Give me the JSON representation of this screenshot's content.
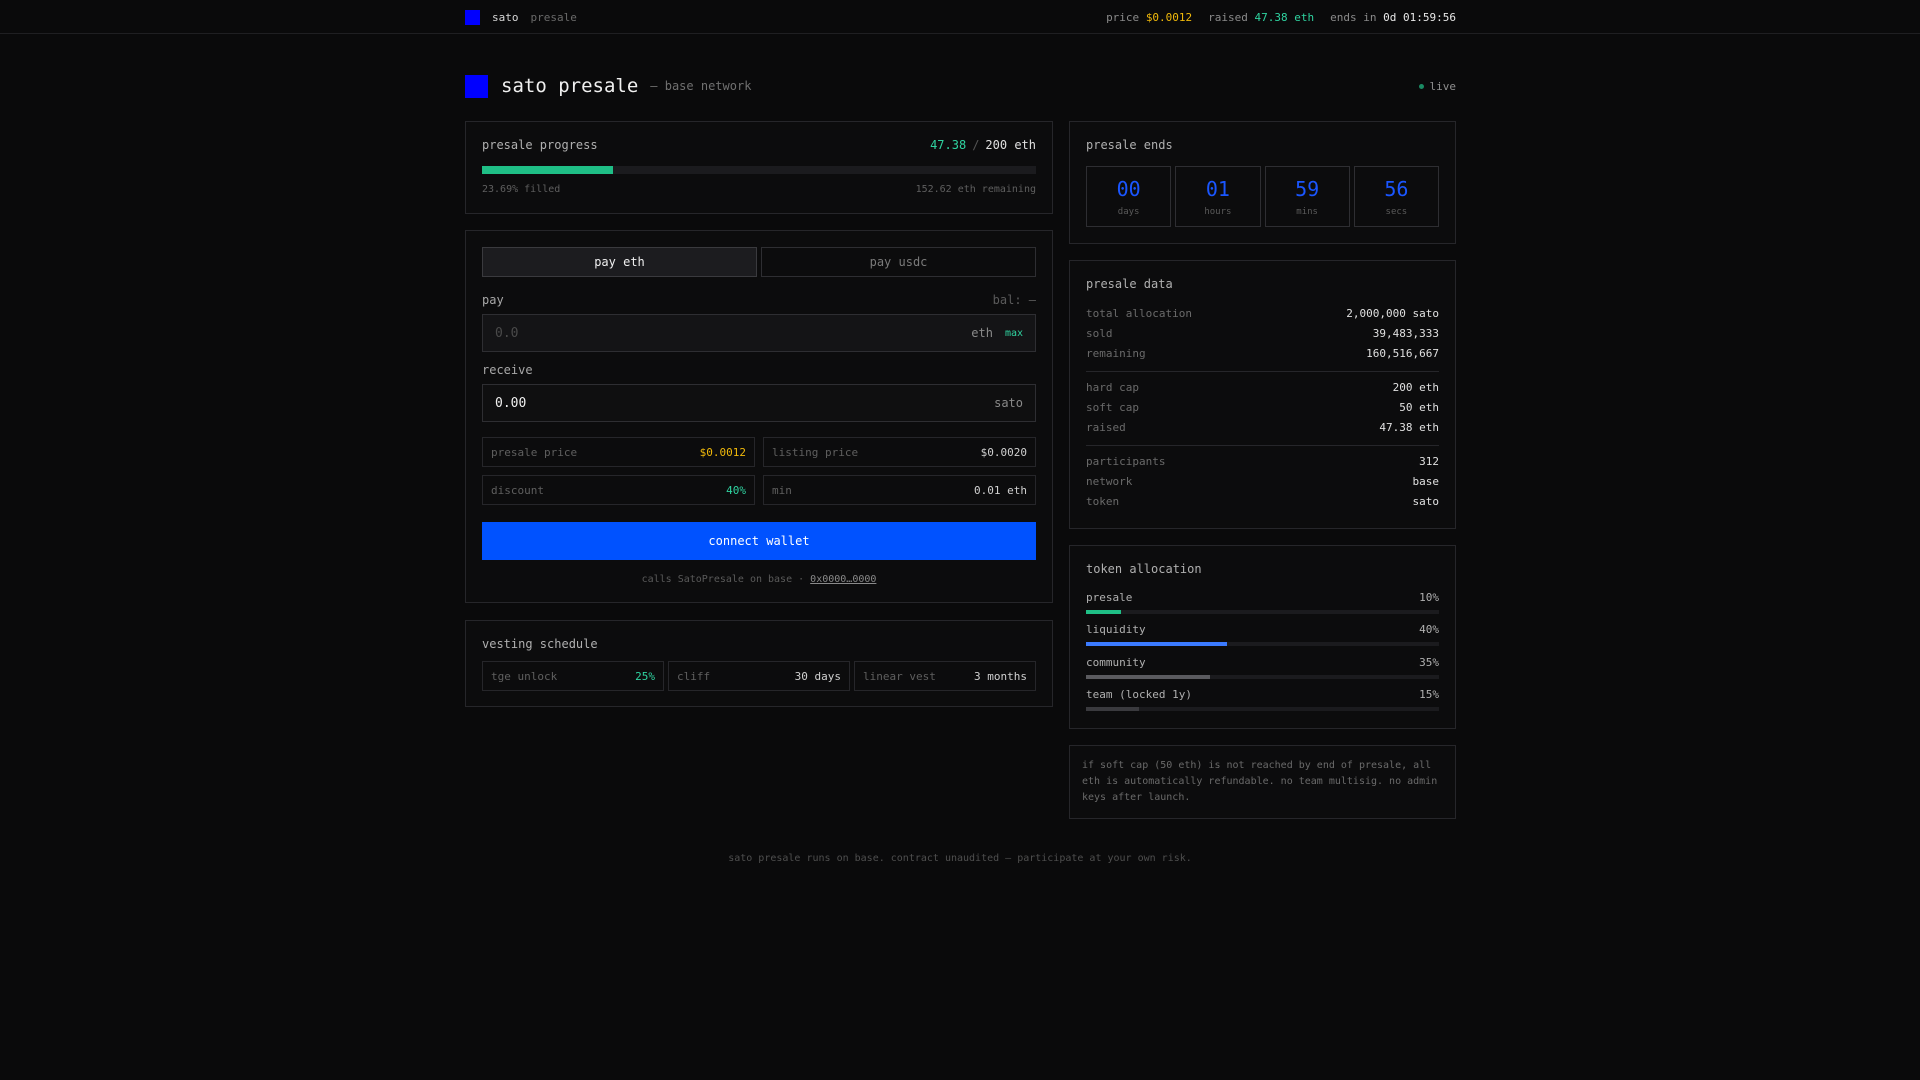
{
  "topbar": {
    "brand": "sato",
    "brand_sub": "presale",
    "price_label": "price",
    "price_value": "$0.0012",
    "raised_label": "raised",
    "raised_value": "47.38 eth",
    "ends_label": "ends in",
    "ends_value": "0d 01:59:56"
  },
  "header": {
    "title": "sato presale",
    "subtitle": "— base network",
    "live": "live"
  },
  "progress": {
    "title": "presale progress",
    "raised": "47.38",
    "sep": "/",
    "cap": "200 eth",
    "fill_fraction": 0.2369,
    "filled_text": "23.69% filled",
    "remaining_text": "152.62 eth remaining"
  },
  "buy": {
    "tab_eth": "pay eth",
    "tab_usdc": "pay usdc",
    "pay_label": "pay",
    "balance": "bal: —",
    "pay_placeholder": "0.0",
    "pay_unit": "eth",
    "max": "max",
    "receive_label": "receive",
    "receive_value": "0.00",
    "receive_unit": "sato",
    "info": [
      {
        "k": "presale price",
        "v": "$0.0012",
        "tone": "yellow"
      },
      {
        "k": "listing price",
        "v": "$0.0020",
        "tone": ""
      },
      {
        "k": "discount",
        "v": "40%",
        "tone": "green"
      },
      {
        "k": "min",
        "v": "0.01 eth",
        "tone": ""
      }
    ],
    "connect": "connect wallet",
    "calls_text": "calls SatoPresale on base ·",
    "calls_link": "0x0000…0000"
  },
  "vesting": {
    "title": "vesting schedule",
    "items": [
      {
        "k": "tge unlock",
        "v": "25%",
        "tone": "green"
      },
      {
        "k": "cliff",
        "v": "30 days",
        "tone": ""
      },
      {
        "k": "linear vest",
        "v": "3 months",
        "tone": ""
      }
    ]
  },
  "countdown": {
    "title": "presale ends",
    "cells": [
      {
        "num": "00",
        "lbl": "days"
      },
      {
        "num": "01",
        "lbl": "hours"
      },
      {
        "num": "59",
        "lbl": "mins"
      },
      {
        "num": "56",
        "lbl": "secs"
      }
    ]
  },
  "data": {
    "title": "presale data",
    "rows": [
      {
        "k": "total allocation",
        "v": "2,000,000 sato",
        "tone": ""
      },
      {
        "k": "sold",
        "v": "39,483,333",
        "tone": "green"
      },
      {
        "k": "remaining",
        "v": "160,516,667",
        "tone": ""
      },
      {
        "k": "hard cap",
        "v": "200 eth",
        "tone": ""
      },
      {
        "k": "soft cap",
        "v": "50 eth",
        "tone": ""
      },
      {
        "k": "raised",
        "v": "47.38 eth",
        "tone": "green"
      },
      {
        "k": "participants",
        "v": "312",
        "tone": ""
      },
      {
        "k": "network",
        "v": "base",
        "tone": "blue"
      },
      {
        "k": "token",
        "v": "sato",
        "tone": ""
      }
    ]
  },
  "allocation": {
    "title": "token allocation",
    "items": [
      {
        "name": "presale",
        "pct": "10%",
        "fraction": 0.1,
        "color": "#1fbf86"
      },
      {
        "name": "liquidity",
        "pct": "40%",
        "fraction": 0.4,
        "color": "#3b7bff"
      },
      {
        "name": "community",
        "pct": "35%",
        "fraction": 0.35,
        "color": "#5a5a5e"
      },
      {
        "name": "team (locked 1y)",
        "pct": "15%",
        "fraction": 0.15,
        "color": "#3a3a3e"
      }
    ]
  },
  "note": "if soft cap (50 eth) is not reached by end of presale, all eth is automatically refundable. no team multisig. no admin keys after launch.",
  "footer": "sato presale runs on base. contract unaudited — participate at your own risk."
}
